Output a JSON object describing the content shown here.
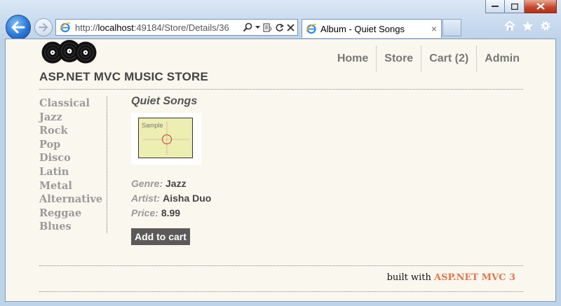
{
  "browser": {
    "address": {
      "scheme": "http://",
      "host": "localhost",
      "rest": ":49184/Store/Details/36"
    },
    "tab_title": "Album - Quiet Songs",
    "tab_close": "×",
    "icons": {
      "back": "back-arrow-icon",
      "forward": "forward-arrow-icon",
      "search": "search-icon",
      "home": "home-icon",
      "favorites": "star-icon",
      "tools": "gear-icon"
    }
  },
  "header": {
    "store_title": "ASP.NET MVC MUSIC STORE",
    "nav": [
      {
        "label": "Home"
      },
      {
        "label": "Store"
      },
      {
        "label": "Cart (2)"
      },
      {
        "label": "Admin"
      }
    ]
  },
  "genres": [
    "Classical",
    "Jazz",
    "Rock",
    "Pop",
    "Disco",
    "Latin",
    "Metal",
    "Alternative",
    "Reggae",
    "Blues"
  ],
  "album": {
    "title": "Quiet Songs",
    "art_text": "Sample",
    "genre_label": "Genre:",
    "genre": "Jazz",
    "artist_label": "Artist:",
    "artist": "Aisha Duo",
    "price_label": "Price:",
    "price": "8.99",
    "add_to_cart": "Add to cart"
  },
  "footer": {
    "prefix": "built with ",
    "brand": "ASP.NET MVC 3"
  },
  "colors": {
    "page_bg": "#faf7ee",
    "accent": "#e4764c",
    "nav_text": "#777777",
    "button_bg": "#5b5a58"
  }
}
